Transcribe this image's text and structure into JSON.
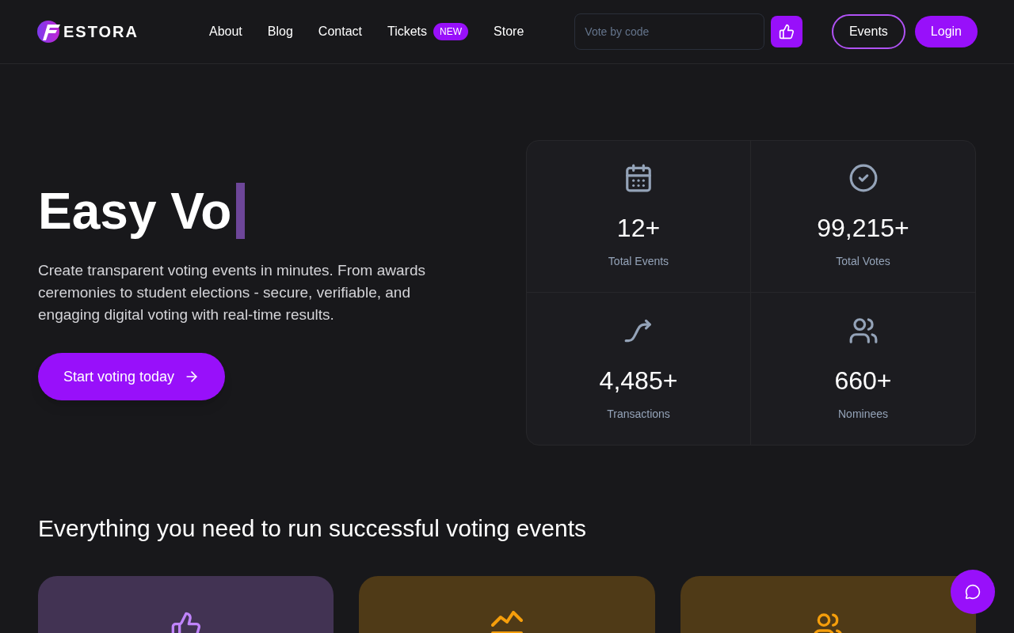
{
  "header": {
    "logo_text": "ESTORA",
    "nav": [
      {
        "label": "About"
      },
      {
        "label": "Blog"
      },
      {
        "label": "Contact"
      },
      {
        "label": "Tickets",
        "badge": "NEW"
      },
      {
        "label": "Store"
      }
    ],
    "search": {
      "placeholder": "Vote by code"
    },
    "buttons": [
      "Events",
      "Login"
    ]
  },
  "hero": {
    "title": "Easy Vo",
    "description": "Create transparent voting events in minutes. From awards ceremonies to student elections - secure, verifiable, and engaging digital voting with real-time results.",
    "cta": "Start voting today"
  },
  "stats": [
    {
      "value": "12+",
      "label": "Total Events"
    },
    {
      "value": "99,215+",
      "label": "Total Votes"
    },
    {
      "value": "4,485+",
      "label": "Transactions"
    },
    {
      "value": "660+",
      "label": "Nominees"
    }
  ],
  "features": {
    "title": "Everything you need to run successful voting events",
    "cards": [
      {
        "color": "#c084fc"
      },
      {
        "color": "#f59e0b"
      },
      {
        "color": "#f59e0b"
      }
    ]
  }
}
